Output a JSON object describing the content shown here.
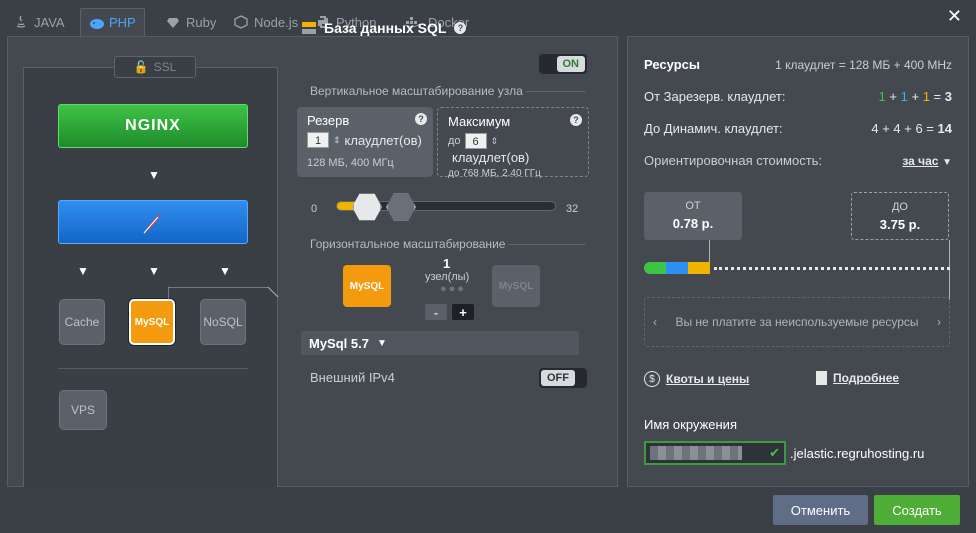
{
  "tabs": [
    {
      "label": "JAVA",
      "icon": "java-icon"
    },
    {
      "label": "PHP",
      "icon": "php-icon"
    },
    {
      "label": "Ruby",
      "icon": "ruby-icon"
    },
    {
      "label": "Node.js",
      "icon": "nodejs-icon"
    },
    {
      "label": "Python",
      "icon": "python-icon"
    },
    {
      "label": "Docker",
      "icon": "docker-icon"
    }
  ],
  "topology": {
    "ssl_label": "SSL",
    "balancer": "NGINX",
    "nodes": {
      "cache": "Cache",
      "mysql": "MySQL",
      "nosql": "NoSQL",
      "vps": "VPS"
    }
  },
  "config": {
    "title": "База данных SQL",
    "toggle_on": "ON",
    "vertical_label": "Вертикальное масштабирование узла",
    "reserve_title": "Резерв",
    "reserve_value": "1",
    "cloudlets_label": "клаудлет(ов)",
    "reserve_spec": "128 МБ, 400 МГц",
    "max_title": "Максимум",
    "max_prefix": "до",
    "max_value": "6",
    "max_spec": "до 768 МБ, 2.40 ГГц",
    "slider_min": "0",
    "slider_max": "32",
    "horizontal_label": "Горизонтальное масштабирование",
    "node_count": "1",
    "node_unit": "узел(лы)",
    "minus": "-",
    "plus": "+",
    "version": "MySql 5.7",
    "ipv4_label": "Внешний IPv4",
    "ipv4_toggle": "OFF"
  },
  "resources": {
    "title": "Ресурсы",
    "cloudlet_def": "1 клаудлет = 128 МБ + 400 МHz",
    "reserved_label": "От Зарезерв. клаудлет:",
    "reserved_parts": [
      "1",
      "+",
      "1",
      "+",
      "1",
      "="
    ],
    "reserved_total": "3",
    "dynamic_label": "До Динамич. клаудлет:",
    "dynamic_formula": "4 + 4 + 6 =",
    "dynamic_total": "14",
    "cost_label": "Ориентировочная стоимость:",
    "period": "за час",
    "from_label": "ОТ",
    "from_value": "0.78 р.",
    "to_label": "ДО",
    "to_value": "3.75 р.",
    "message": "Вы не платите за неиспользуемые ресурсы",
    "quotas_link": "Квоты и цены",
    "more_link": "Подробнее",
    "env_label": "Имя окружения",
    "env_domain": ".jelastic.regruhosting.ru"
  },
  "buttons": {
    "cancel": "Отменить",
    "create": "Создать"
  },
  "colors": {
    "green": "#3fc347",
    "blue": "#2f8ff0",
    "orange": "#f39a0f",
    "yellow": "#f0b400",
    "cyan": "#2fb6e8",
    "link_blue": "#4ea3ff"
  }
}
